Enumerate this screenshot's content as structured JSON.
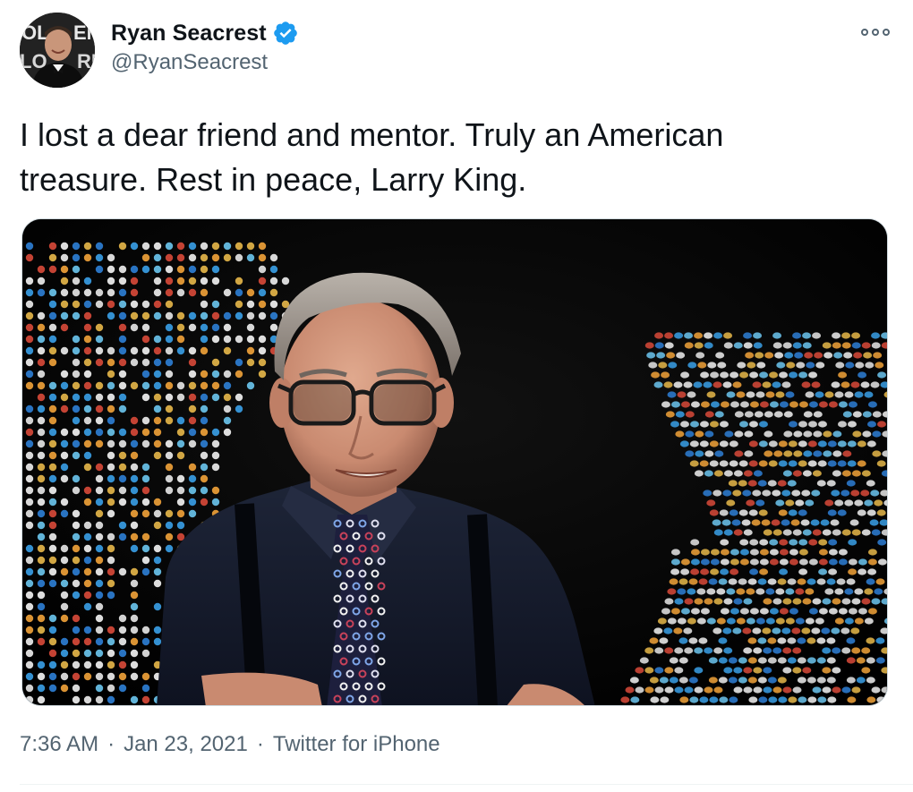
{
  "author": {
    "display_name": "Ryan Seacrest",
    "handle": "@RyanSeacrest",
    "verified": true,
    "avatar_icon": "user-avatar-photo"
  },
  "tweet": {
    "text_line1": "I lost a dear friend and mentor. Truly an American",
    "text_line2": "treasure. Rest in peace, Larry King."
  },
  "media": {
    "icon": "photo-larry-king-with-led-map"
  },
  "meta": {
    "time": "7:36 AM",
    "separator1": "·",
    "date": "Jan 23, 2021",
    "separator2": "·",
    "source": "Twitter for iPhone"
  },
  "icons": {
    "more": "more-options-icon",
    "verified": "verified-badge-icon"
  },
  "colors": {
    "text": "#0f1419",
    "secondary_text": "#536471",
    "verified_blue": "#1d9bf0"
  }
}
